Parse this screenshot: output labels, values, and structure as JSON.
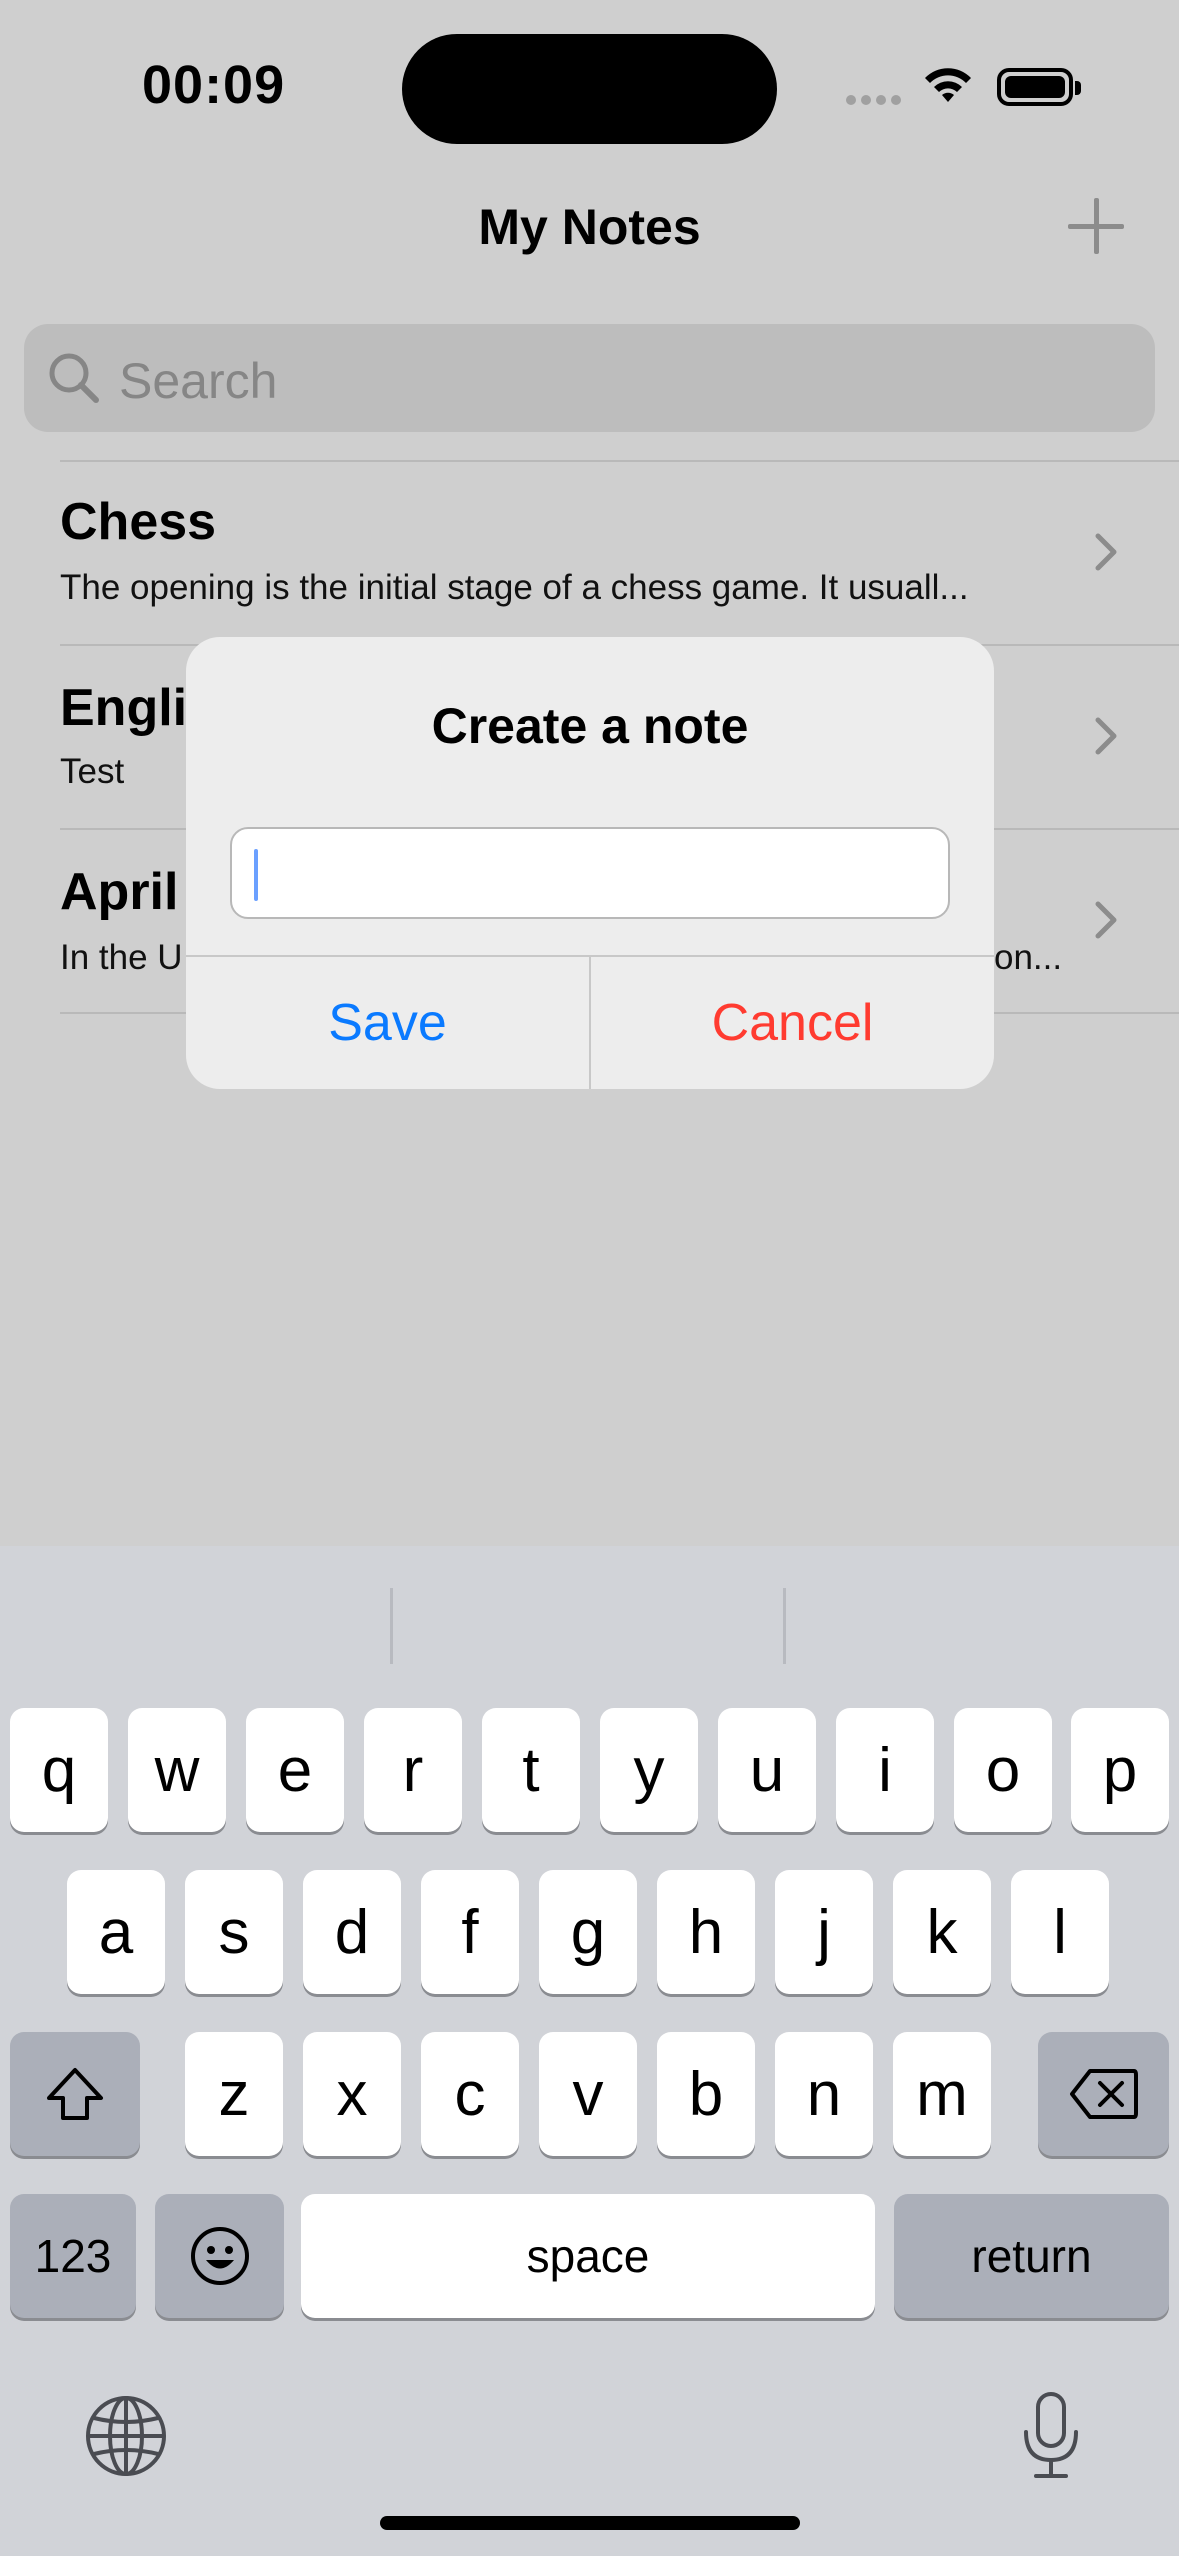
{
  "status_bar": {
    "time": "00:09"
  },
  "nav": {
    "title": "My Notes",
    "add_icon": "plus-icon"
  },
  "search": {
    "placeholder": "Search"
  },
  "notes": [
    {
      "title": "Chess",
      "subtitle": "The opening is the initial stage of a chess game. It usuall..."
    },
    {
      "title": "Engli",
      "subtitle": "Test"
    },
    {
      "title": "April",
      "subtitle": "In the U",
      "subtitle_tail": "on..."
    }
  ],
  "alert": {
    "title": "Create a note",
    "input_value": "",
    "save_label": "Save",
    "cancel_label": "Cancel",
    "colors": {
      "save": "#0a7aff",
      "cancel": "#ff3b30"
    }
  },
  "keyboard": {
    "row1": [
      "q",
      "w",
      "e",
      "r",
      "t",
      "y",
      "u",
      "i",
      "o",
      "p"
    ],
    "row2": [
      "a",
      "s",
      "d",
      "f",
      "g",
      "h",
      "j",
      "k",
      "l"
    ],
    "row3": [
      "z",
      "x",
      "c",
      "v",
      "b",
      "n",
      "m"
    ],
    "numbers_label": "123",
    "space_label": "space",
    "return_label": "return"
  }
}
